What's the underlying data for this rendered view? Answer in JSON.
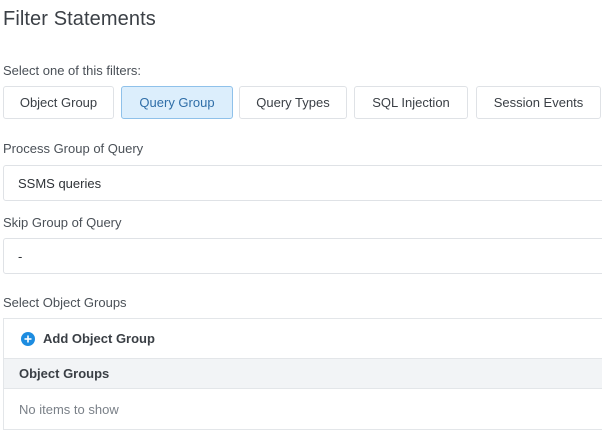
{
  "page": {
    "title": "Filter Statements"
  },
  "filters": {
    "prompt": "Select one of this filters:",
    "tabs": [
      {
        "label": "Object Group",
        "active": false
      },
      {
        "label": "Query Group",
        "active": true
      },
      {
        "label": "Query Types",
        "active": false
      },
      {
        "label": "SQL Injection",
        "active": false
      },
      {
        "label": "Session Events",
        "active": false
      }
    ]
  },
  "process_group": {
    "label": "Process Group of Query",
    "value": "SSMS queries"
  },
  "skip_group": {
    "label": "Skip Group of Query",
    "value": "-"
  },
  "object_groups": {
    "label": "Select Object Groups",
    "add_label": "Add Object Group",
    "column_header": "Object Groups",
    "empty_text": "No items to show"
  },
  "colors": {
    "accent": "#1d8ce0",
    "active_tab_bg": "#dceefc",
    "active_tab_border": "#8fc1ea",
    "active_tab_text": "#2f6ea8"
  }
}
